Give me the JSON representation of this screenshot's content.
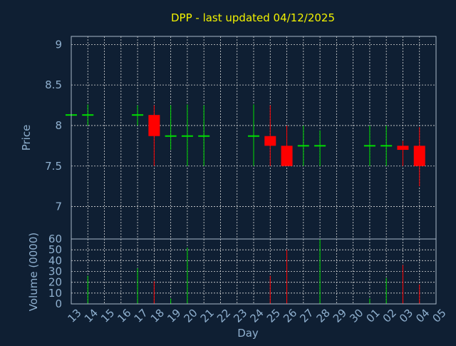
{
  "chart_data": {
    "type": "candlestick",
    "title": "DPP - last updated 04/12/2025",
    "xlabel": "Day",
    "price_panel": {
      "ylabel": "Price",
      "ylim": [
        6.6,
        9.1
      ],
      "yticks": [
        7,
        7.5,
        8,
        8.5,
        9
      ],
      "ytick_labels": [
        "7",
        "7.5",
        "8",
        "8.5",
        "9"
      ]
    },
    "volume_panel": {
      "ylabel": "Volume (0000)",
      "ylim": [
        0,
        60
      ],
      "yticks": [
        0,
        10,
        20,
        30,
        40,
        50,
        60
      ],
      "ytick_labels": [
        "0",
        "10",
        "20",
        "30",
        "40",
        "50",
        "60"
      ]
    },
    "x_tick_labels": [
      "13",
      "14",
      "15",
      "16",
      "17",
      "18",
      "19",
      "20",
      "21",
      "22",
      "23",
      "24",
      "25",
      "26",
      "27",
      "28",
      "29",
      "30",
      "01",
      "02",
      "03",
      "04",
      "05"
    ],
    "grid": true,
    "colors": {
      "up": "#00dd00",
      "down": "#ff0000",
      "title": "#f2f200",
      "axis_text": "#8fb0cf",
      "background": "#0f1f33"
    },
    "candles": [
      {
        "day": "13",
        "open": 8.13,
        "high": 8.13,
        "low": 8.13,
        "close": 8.13,
        "volume": 0
      },
      {
        "day": "14",
        "open": 8.13,
        "high": 8.26,
        "low": 8.0,
        "close": 8.13,
        "volume": 26
      },
      {
        "day": "17",
        "open": 8.13,
        "high": 8.25,
        "low": 8.0,
        "close": 8.13,
        "volume": 33
      },
      {
        "day": "18",
        "open": 8.13,
        "high": 8.25,
        "low": 7.5,
        "close": 7.87,
        "volume": 21
      },
      {
        "day": "19",
        "open": 7.87,
        "high": 8.25,
        "low": 7.7,
        "close": 7.87,
        "volume": 5
      },
      {
        "day": "20",
        "open": 7.87,
        "high": 8.26,
        "low": 7.5,
        "close": 7.87,
        "volume": 52
      },
      {
        "day": "21",
        "open": 7.87,
        "high": 8.25,
        "low": 7.5,
        "close": 7.87,
        "volume": 0
      },
      {
        "day": "24",
        "open": 7.87,
        "high": 8.26,
        "low": 7.5,
        "close": 7.87,
        "volume": 0
      },
      {
        "day": "25",
        "open": 7.87,
        "high": 8.25,
        "low": 7.5,
        "close": 7.75,
        "volume": 26
      },
      {
        "day": "26",
        "open": 7.75,
        "high": 8.0,
        "low": 7.5,
        "close": 7.5,
        "volume": 50
      },
      {
        "day": "27",
        "open": 7.75,
        "high": 8.0,
        "low": 7.5,
        "close": 7.75,
        "volume": 0
      },
      {
        "day": "28",
        "open": 7.75,
        "high": 7.94,
        "low": 7.5,
        "close": 7.75,
        "volume": 60
      },
      {
        "day": "01",
        "open": 7.75,
        "high": 8.0,
        "low": 7.5,
        "close": 7.75,
        "volume": 5
      },
      {
        "day": "02",
        "open": 7.75,
        "high": 8.0,
        "low": 7.5,
        "close": 7.75,
        "volume": 24
      },
      {
        "day": "03",
        "open": 7.75,
        "high": 7.81,
        "low": 7.5,
        "close": 7.7,
        "volume": 36
      },
      {
        "day": "04",
        "open": 7.75,
        "high": 7.98,
        "low": 7.25,
        "close": 7.5,
        "volume": 18
      }
    ]
  }
}
